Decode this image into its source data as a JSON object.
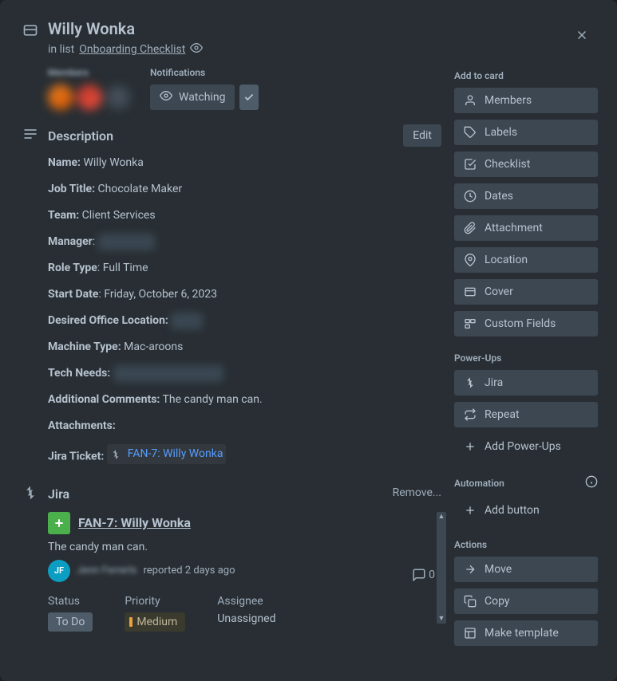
{
  "header": {
    "title": "Willy Wonka",
    "in_list_prefix": "in list ",
    "list_name": "Onboarding Checklist"
  },
  "members_section": {
    "heading": "Members"
  },
  "notifications": {
    "heading": "Notifications",
    "watching_label": "Watching"
  },
  "description": {
    "heading": "Description",
    "edit_label": "Edit",
    "fields": {
      "name_label": "Name:",
      "name_value": "Willy Wonka",
      "job_title_label": "Job Title:",
      "job_title_value": "Chocolate Maker",
      "team_label": "Team:",
      "team_value": "Client Services",
      "manager_label": "Manager",
      "manager_value": "John Smith",
      "role_type_label": "Role Type",
      "role_type_value": "Full Time",
      "start_date_label": "Start Date",
      "start_date_value": "Friday, October 6, 2023",
      "office_loc_label": "Desired Office Location:",
      "office_loc_value": "Austin",
      "machine_label": "Machine Type:",
      "machine_value": "Mac-aroons",
      "tech_needs_label": "Tech Needs:",
      "tech_needs_value": "Hardware accessories",
      "comments_label": "Additional Comments:",
      "comments_value": "The candy man can.",
      "attachments_label": "Attachments:",
      "jira_label": "Jira Ticket:",
      "jira_value": "FAN-7: Willy Wonka"
    }
  },
  "jira_section": {
    "heading": "Jira",
    "remove_label": "Remove...",
    "title": "FAN-7: Willy Wonka",
    "desc": "The candy man can.",
    "reporter": "Jenn Ferrerls",
    "reported_suffix": "reported 2 days ago",
    "avatar_initials": "JF",
    "comment_count": "0",
    "fields": {
      "status_label": "Status",
      "status_value": "To Do",
      "priority_label": "Priority",
      "priority_value": "Medium",
      "assignee_label": "Assignee",
      "assignee_value": "Unassigned"
    }
  },
  "sidebar": {
    "add_to_card": {
      "heading": "Add to card",
      "items": {
        "members": "Members",
        "labels": "Labels",
        "checklist": "Checklist",
        "dates": "Dates",
        "attachment": "Attachment",
        "location": "Location",
        "cover": "Cover",
        "custom_fields": "Custom Fields"
      }
    },
    "powerups": {
      "heading": "Power-Ups",
      "jira": "Jira",
      "repeat": "Repeat",
      "add": "Add Power-Ups"
    },
    "automation": {
      "heading": "Automation",
      "add_button": "Add button"
    },
    "actions": {
      "heading": "Actions",
      "move": "Move",
      "copy": "Copy",
      "template": "Make template"
    }
  }
}
